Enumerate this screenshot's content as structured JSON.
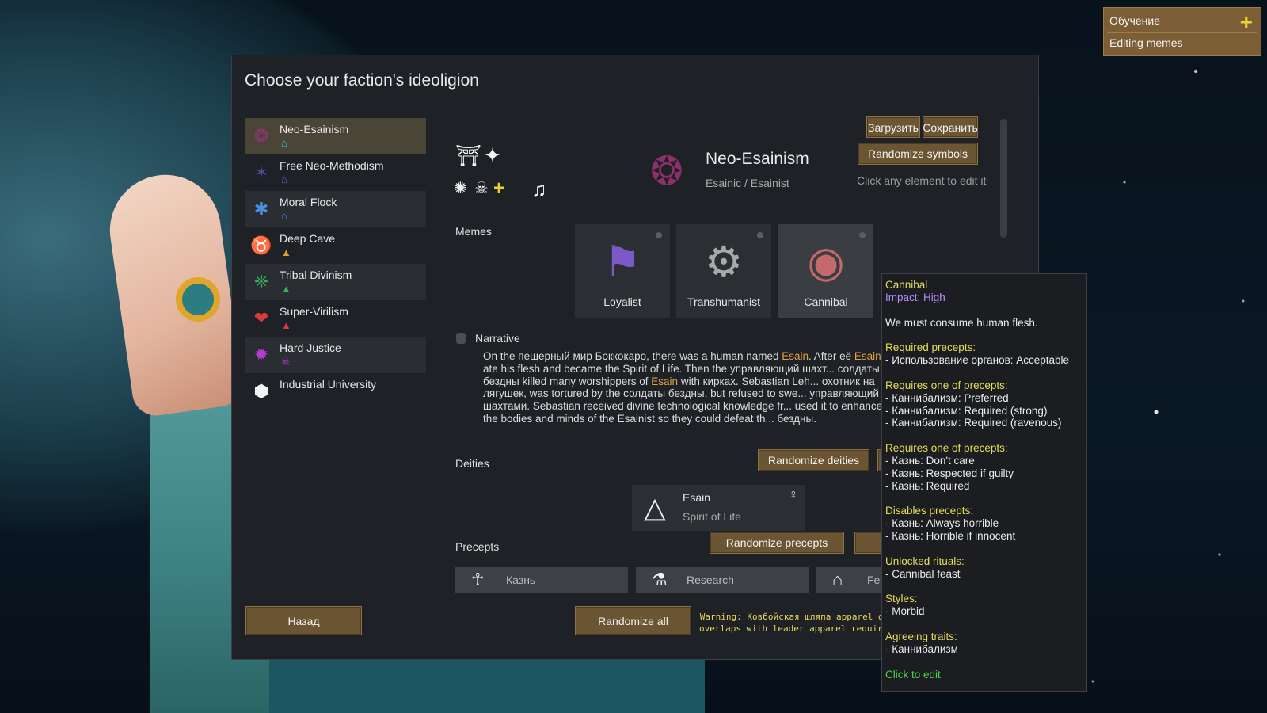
{
  "dialog": {
    "title": "Choose your faction's ideoligion"
  },
  "factions": [
    {
      "name": "Neo-Esainism",
      "icon": "❂",
      "icon_color": "#8c3470",
      "glyph": "⌂",
      "glyph_color": "#3fc6e0",
      "selected": true
    },
    {
      "name": "Free Neo-Methodism",
      "icon": "✶",
      "icon_color": "#4b4a9a",
      "glyph": "⌂",
      "glyph_color": "#6a5acd",
      "selected": false
    },
    {
      "name": "Moral Flock",
      "icon": "✱",
      "icon_color": "#4a8ee0",
      "glyph": "⌂",
      "glyph_color": "#4a8ee0",
      "selected": false
    },
    {
      "name": "Deep Cave",
      "icon": "♉",
      "icon_color": "#d6a526",
      "glyph": "▲",
      "glyph_color": "#d6a526",
      "selected": false
    },
    {
      "name": "Tribal Divinism",
      "icon": "❈",
      "icon_color": "#38b35a",
      "glyph": "▲",
      "glyph_color": "#38b35a",
      "selected": false
    },
    {
      "name": "Super-Virilism",
      "icon": "❤",
      "icon_color": "#d63c3c",
      "glyph": "▲",
      "glyph_color": "#d63c3c",
      "selected": false
    },
    {
      "name": "Hard Justice",
      "icon": "✹",
      "icon_color": "#b43ccf",
      "glyph": "☠",
      "glyph_color": "#b43ccf",
      "selected": false
    },
    {
      "name": "Industrial University",
      "icon": "⬢",
      "icon_color": "#f2f2f2",
      "glyph": "",
      "glyph_color": "#f2f2f2",
      "selected": false
    }
  ],
  "symbols": {
    "emblem": "❂",
    "name": "Neo-Esainism",
    "adjective": "Esainic / Esainist"
  },
  "buttons": {
    "load": "Загрузить",
    "save": "Сохранить",
    "randomize_symbols": "Randomize symbols",
    "randomize_deities": "Randomize deities",
    "randomize_precepts": "Randomize precepts",
    "randomize_all": "Randomize all",
    "back": "Назад"
  },
  "hint": "Click any element to edit it",
  "memes": {
    "label": "Memes",
    "items": [
      {
        "name": "Loyalist",
        "icon": "⚑"
      },
      {
        "name": "Transhumanist",
        "icon": "⚙"
      },
      {
        "name": "Cannibal",
        "icon": "◉"
      }
    ]
  },
  "narrative": {
    "label": "Narrative",
    "parts": [
      {
        "text": "On the пещерный мир Боккокаро, there was a human named ",
        "hl": false
      },
      {
        "text": "Esain",
        "hl": true
      },
      {
        "text": ". After её ",
        "hl": false
      },
      {
        "text": "Esain",
        "hl": true
      },
      {
        "text": " ate his flesh and became the Spirit of Life. Then the управляющий шахт... солдаты бездны killed many worshippers of ",
        "hl": false
      },
      {
        "text": "Esain",
        "hl": true
      },
      {
        "text": " with кирках. Sebastian Leh... охотник на лягушек, was tortured by the солдаты бездны, but refused to swe... управляющий шахтами. Sebastian received divine technological knowledge fr... used it to enhance the bodies and minds of the Esainist so they could defeat th... бездны.",
        "hl": false
      }
    ]
  },
  "deities": {
    "label": "Deities",
    "items": [
      {
        "name": "Esain",
        "type": "Spirit of Life",
        "gender": "♀",
        "symbol": "△"
      }
    ]
  },
  "precepts": {
    "label": "Precepts",
    "items": [
      {
        "name": "Казнь",
        "icon": "☥"
      },
      {
        "name": "Research",
        "icon": "⚗"
      },
      {
        "name": "Fe",
        "icon": "⌂"
      }
    ]
  },
  "warning": {
    "line1": "Warning: Ковбойская шляпа apparel de",
    "line2": "overlaps with leader apparel requirem"
  },
  "tooltip": {
    "title": "Cannibal",
    "impact": "Impact: High",
    "desc": "We must consume human flesh.",
    "sections": [
      {
        "header": "Required precepts:",
        "items": [
          "- Использование органов: Acceptable"
        ]
      },
      {
        "header": "Requires one of precepts:",
        "items": [
          "- Каннибализм: Preferred",
          "- Каннибализм: Required (strong)",
          "- Каннибализм: Required (ravenous)"
        ]
      },
      {
        "header": "Requires one of precepts:",
        "items": [
          "- Казнь: Don't care",
          "- Казнь: Respected if guilty",
          "- Казнь: Required"
        ]
      },
      {
        "header": "Disables precepts:",
        "items": [
          "- Казнь: Always horrible",
          "- Казнь: Horrible if innocent"
        ]
      },
      {
        "header": "Unlocked rituals:",
        "items": [
          "- Cannibal feast"
        ]
      },
      {
        "header": "Styles:",
        "items": [
          "- Morbid"
        ]
      },
      {
        "header": "Agreeing traits:",
        "items": [
          "- Каннибализм"
        ]
      }
    ],
    "footer": "Click to edit"
  },
  "lesson": {
    "title": "Обучение",
    "item": "Editing memes"
  }
}
